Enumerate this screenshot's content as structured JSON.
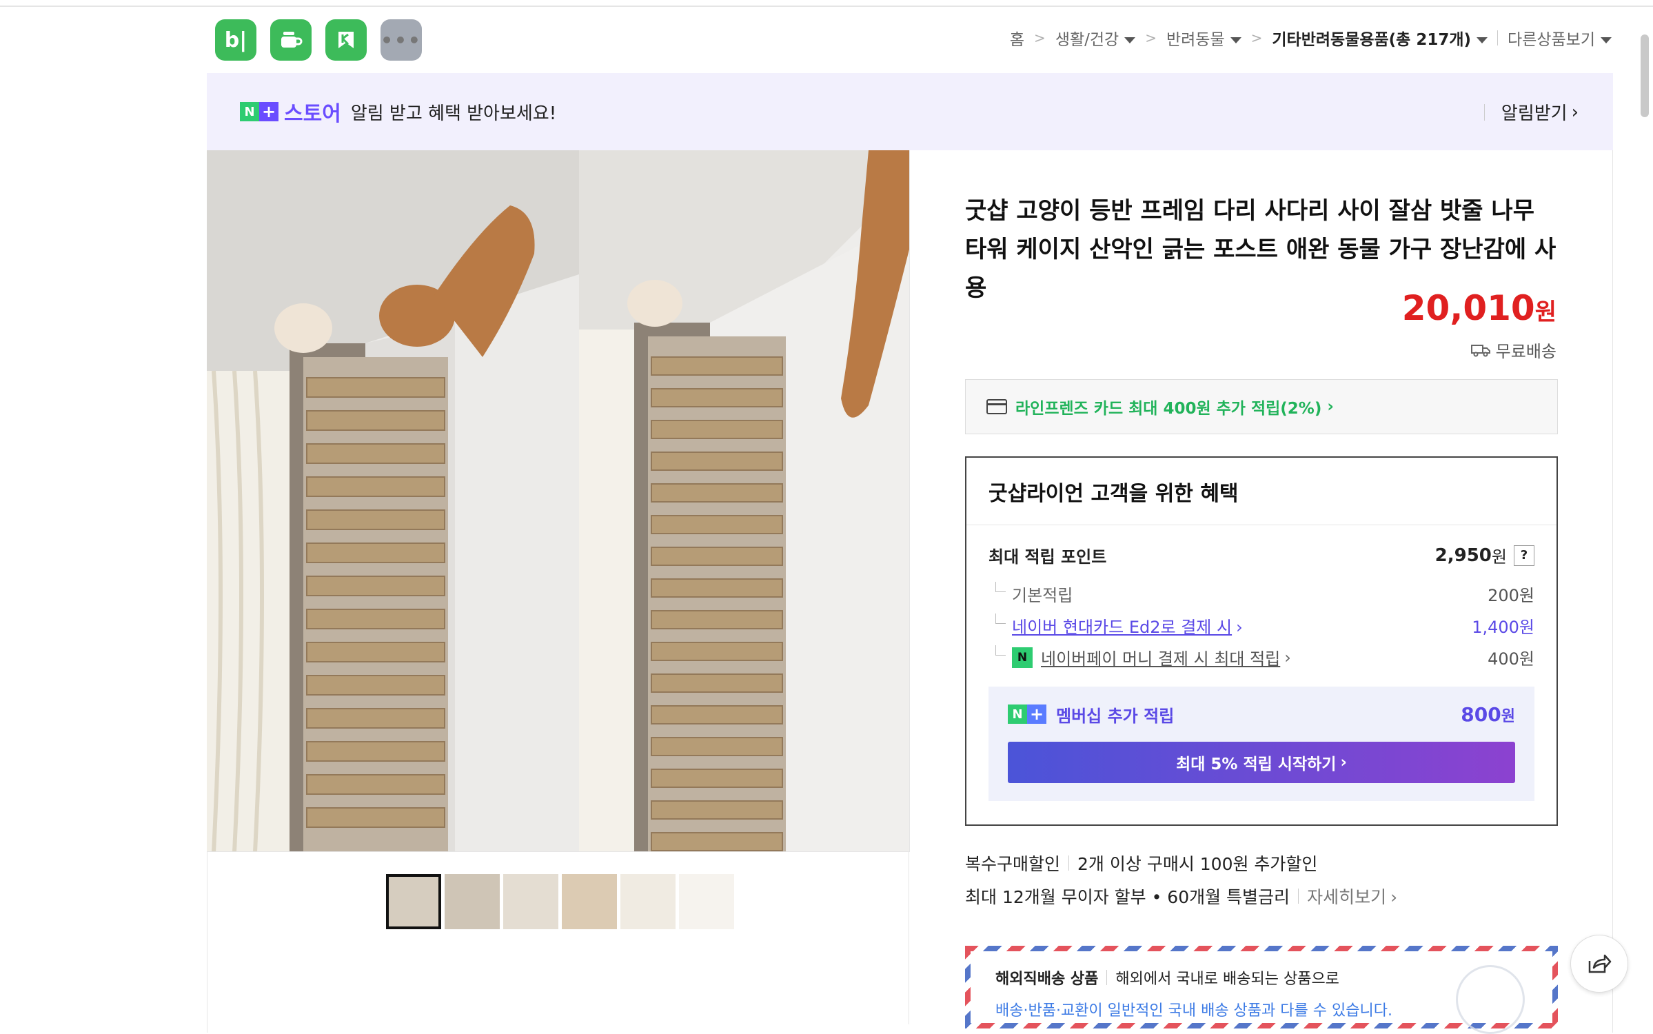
{
  "header": {
    "apps": [
      {
        "label": "b|",
        "icon": "blog-icon",
        "color": "#3dbb5a"
      },
      {
        "label": "☕",
        "icon": "cafe-icon",
        "color": "#3dbb5a"
      },
      {
        "label": "K",
        "icon": "kin-icon",
        "color": "#3dbb5a"
      },
      {
        "label": "•••",
        "icon": "more-icon",
        "color": "#a3a9b3"
      }
    ],
    "breadcrumb": {
      "home": "홈",
      "level1": "생활/건강",
      "level2": "반려동물",
      "level3": "기타반려동물용품(총 217개)",
      "other": "다른상품보기"
    }
  },
  "store_banner": {
    "badge_n": "N",
    "badge_plus": "+",
    "store_word": "스토어",
    "message": "알림 받고 혜택 받아보세요!",
    "action": "알림받기"
  },
  "product": {
    "title": "굿샵 고양이 등반 프레임 다리 사다리 사이 잘삼 밧줄 나무 타워 케이지 산악인 긁는 포스트 애완 동물 가구 장난감에 사용",
    "price": "20,010",
    "price_unit": "원",
    "shipping": "무료배송",
    "card_offer": "라인프렌즈 카드 최대 400원 추가 적립(2%)",
    "thumbnail_count": 6
  },
  "benefits": {
    "heading": "굿샵라이언 고객을 위한 혜택",
    "max_points_label": "최대 적립 포인트",
    "max_points_value": "2,950",
    "max_points_unit": "원",
    "help": "?",
    "basic_label": "기본적립",
    "basic_value": "200원",
    "card_label": "네이버 현대카드 Ed2로 결제 시",
    "card_value": "1,400원",
    "npay_label": "네이버페이 머니 결제 시 최대 적립",
    "npay_value": "400원",
    "npay_icon": "N",
    "membership_label": "멤버십 추가 적립",
    "membership_value": "800",
    "membership_unit": "원",
    "cta": "최대 5% 적립 시작하기"
  },
  "extra": {
    "multi_label": "복수구매할인",
    "multi_desc": "2개 이상 구매시 100원 추가할인",
    "installment": "최대 12개월 무이자 할부 • 60개월 특별금리",
    "detail_link": "자세히보기"
  },
  "overseas": {
    "label": "해외직배송 상품",
    "desc": "해외에서 국내로 배송되는 상품으로",
    "note": "배송·반품·교환이 일반적인 국내 배송 상품과 다를 수 있습니다."
  },
  "colors": {
    "price_red": "#e02020",
    "naver_green": "#2ecc71",
    "plus_purple": "#6a4dff",
    "card_green": "#21b35a"
  }
}
